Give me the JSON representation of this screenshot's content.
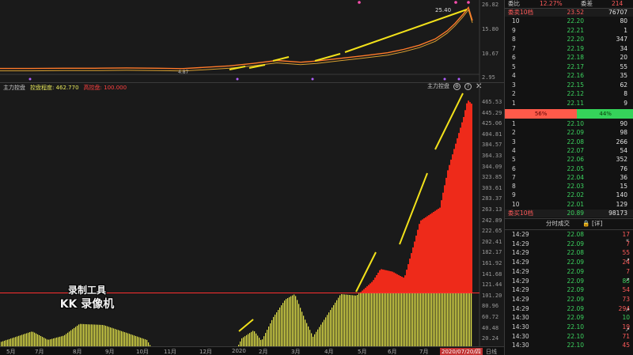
{
  "main_chart": {
    "price_axis": [
      "26.82",
      "15.80",
      "10.67",
      "2.95"
    ],
    "peak_label": "25.40",
    "low_label": "4.87",
    "colors": {
      "price": "#ff7a2a",
      "ma": "#d8a030",
      "arrow": "#f2e11a"
    }
  },
  "indicator": {
    "name": "主力控盘",
    "label1": "控盘程度: 462.770",
    "label2": "高控盘: 100.000",
    "tools_label": "主力控盘",
    "axis": [
      "465.53",
      "445.29",
      "425.06",
      "404.81",
      "384.57",
      "364.33",
      "344.09",
      "323.85",
      "303.61",
      "283.37",
      "263.13",
      "242.89",
      "222.65",
      "202.41",
      "182.17",
      "161.92",
      "141.68",
      "121.44",
      "101.20",
      "80.96",
      "60.72",
      "40.48",
      "20.24"
    ],
    "threshold": 100,
    "colors": {
      "high": "#ee2a1a",
      "low": "#e6e64a",
      "threshold": "#ff3030"
    }
  },
  "watermark": {
    "line1": "录制工具",
    "line2": "KK 录像机"
  },
  "time_axis": {
    "labels": [
      "5月",
      "7月",
      "8月",
      "9月",
      "10月",
      "11月",
      "12月",
      "2020",
      "2月",
      "3月",
      "4月",
      "5月",
      "6月",
      "7月"
    ],
    "cursor": "2020/07/20/四",
    "period": "日线"
  },
  "order_book": {
    "ratio_label": "委比",
    "ratio_value": "12.27%",
    "diff_label": "委差",
    "diff_value": "214",
    "sell_header": "委卖10档",
    "sell_header_price": "23.52",
    "sell_header_vol": "76707",
    "sell": [
      {
        "lvl": "10",
        "price": "22.20",
        "vol": "80"
      },
      {
        "lvl": "9",
        "price": "22.21",
        "vol": "1"
      },
      {
        "lvl": "8",
        "price": "22.20",
        "vol": "347"
      },
      {
        "lvl": "7",
        "price": "22.19",
        "vol": "34"
      },
      {
        "lvl": "6",
        "price": "22.18",
        "vol": "20"
      },
      {
        "lvl": "5",
        "price": "22.17",
        "vol": "55"
      },
      {
        "lvl": "4",
        "price": "22.16",
        "vol": "35"
      },
      {
        "lvl": "3",
        "price": "22.15",
        "vol": "62"
      },
      {
        "lvl": "2",
        "price": "22.12",
        "vol": "8"
      },
      {
        "lvl": "1",
        "price": "22.11",
        "vol": "9"
      }
    ],
    "bar_sell": "56%",
    "bar_buy": "44%",
    "bar_sell_fraction": 0.56,
    "buy": [
      {
        "lvl": "1",
        "price": "22.10",
        "vol": "90"
      },
      {
        "lvl": "2",
        "price": "22.09",
        "vol": "98"
      },
      {
        "lvl": "3",
        "price": "22.08",
        "vol": "266"
      },
      {
        "lvl": "4",
        "price": "22.07",
        "vol": "54"
      },
      {
        "lvl": "5",
        "price": "22.06",
        "vol": "352"
      },
      {
        "lvl": "6",
        "price": "22.05",
        "vol": "76"
      },
      {
        "lvl": "7",
        "price": "22.04",
        "vol": "36"
      },
      {
        "lvl": "8",
        "price": "22.03",
        "vol": "15"
      },
      {
        "lvl": "9",
        "price": "22.02",
        "vol": "140"
      },
      {
        "lvl": "10",
        "price": "22.01",
        "vol": "129"
      }
    ],
    "buy_header": "委买10档",
    "buy_header_price": "20.89",
    "buy_header_vol": "98173"
  },
  "ticks": {
    "title": "分时成交",
    "detail": "[详]",
    "rows": [
      {
        "time": "14:29",
        "price": "22.08",
        "vol": "17",
        "dir": "up"
      },
      {
        "time": "14:29",
        "price": "22.09",
        "vol": "7",
        "dir": "up"
      },
      {
        "time": "14:29",
        "price": "22.08",
        "vol": "55",
        "dir": "up"
      },
      {
        "time": "14:29",
        "price": "22.09",
        "vol": "24",
        "dir": "up"
      },
      {
        "time": "14:29",
        "price": "22.09",
        "vol": "7",
        "dir": "up"
      },
      {
        "time": "14:29",
        "price": "22.09",
        "vol": "85",
        "dir": "dn"
      },
      {
        "time": "14:29",
        "price": "22.09",
        "vol": "54",
        "dir": "up"
      },
      {
        "time": "14:29",
        "price": "22.09",
        "vol": "73",
        "dir": "up"
      },
      {
        "time": "14:29",
        "price": "22.09",
        "vol": "294",
        "dir": "up"
      },
      {
        "time": "14:30",
        "price": "22.09",
        "vol": "10",
        "dir": "dn"
      },
      {
        "time": "14:30",
        "price": "22.10",
        "vol": "19",
        "dir": "up"
      },
      {
        "time": "14:30",
        "price": "22.10",
        "vol": "71",
        "dir": "up"
      },
      {
        "time": "14:30",
        "price": "22.10",
        "vol": "45",
        "dir": "up"
      }
    ]
  }
}
